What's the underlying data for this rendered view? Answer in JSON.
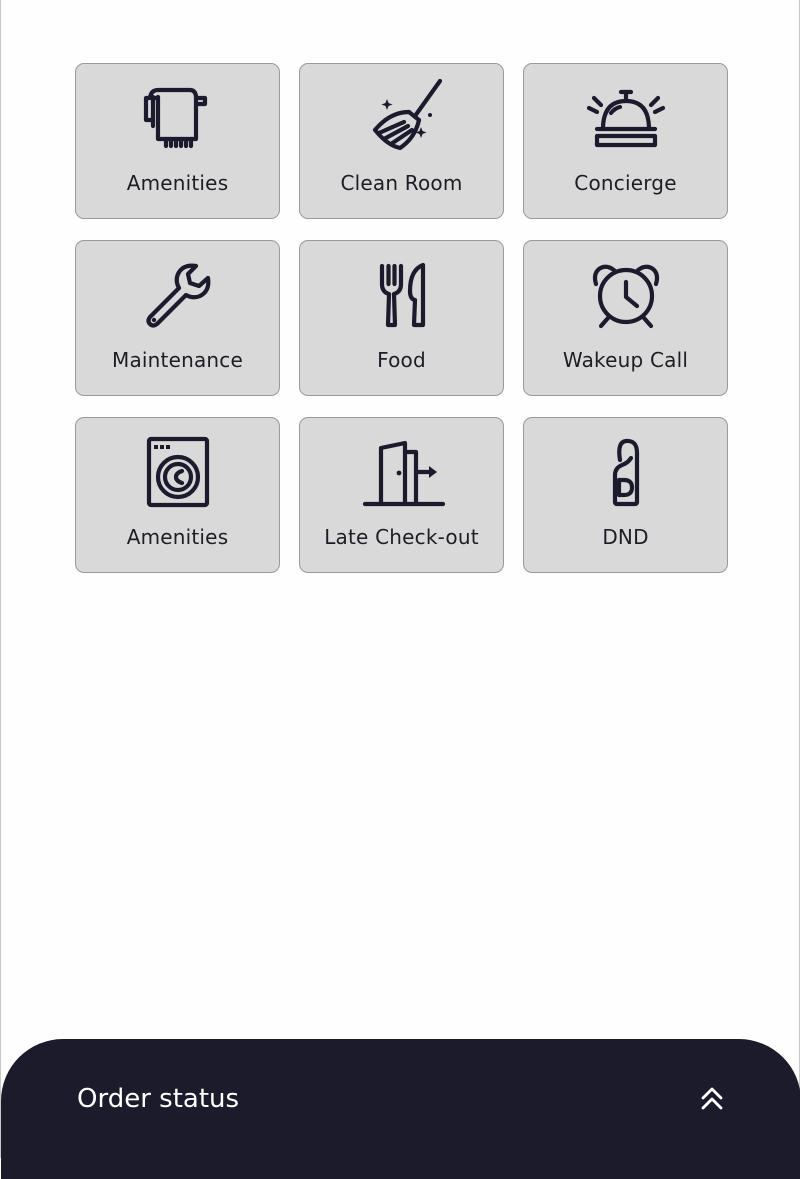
{
  "services": [
    {
      "label": "Amenities",
      "icon": "towel-icon"
    },
    {
      "label": "Clean Room",
      "icon": "broom-icon"
    },
    {
      "label": "Concierge",
      "icon": "service-bell-icon"
    },
    {
      "label": "Maintenance",
      "icon": "wrench-icon"
    },
    {
      "label": "Food",
      "icon": "fork-knife-icon"
    },
    {
      "label": "Wakeup Call",
      "icon": "alarm-clock-icon"
    },
    {
      "label": "Amenities",
      "icon": "washing-machine-icon"
    },
    {
      "label": "Late Check-out",
      "icon": "door-exit-icon"
    },
    {
      "label": "DND",
      "icon": "door-hanger-icon"
    }
  ],
  "order_status": {
    "title": "Order status",
    "toggle_icon": "double-chevron-up-icon"
  },
  "colors": {
    "tile_background": "#d9d9d9",
    "icon_color": "#1c1b2d",
    "panel_background": "#1c1b2b"
  }
}
